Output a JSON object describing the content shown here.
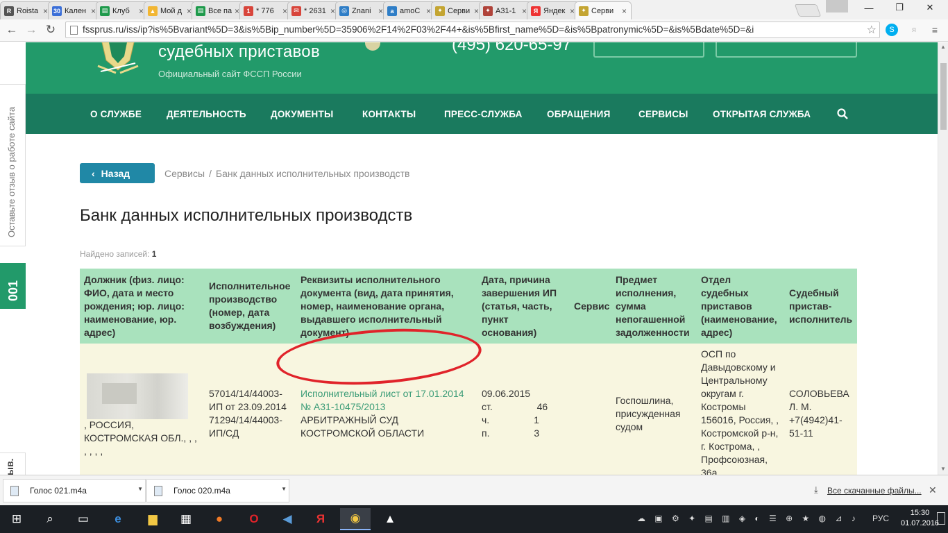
{
  "browser": {
    "tabs": [
      {
        "title": "Roista",
        "fav_color": "#555555",
        "fav_text": "R"
      },
      {
        "title": "Кален",
        "fav_color": "#3b6fd8",
        "fav_text": "30"
      },
      {
        "title": "Клуб",
        "fav_color": "#1e9a4b",
        "fav_text": "▤"
      },
      {
        "title": "Мой д",
        "fav_color": "#f2b632",
        "fav_text": "▲"
      },
      {
        "title": "Все па",
        "fav_color": "#1e9a4b",
        "fav_text": "▤"
      },
      {
        "title": "* 776",
        "fav_color": "#d8453b",
        "fav_text": "1"
      },
      {
        "title": "* 2631",
        "fav_color": "#d8453b",
        "fav_text": "✉"
      },
      {
        "title": "Znani",
        "fav_color": "#2f7ec7",
        "fav_text": "◎"
      },
      {
        "title": "amoC",
        "fav_color": "#2f7ec7",
        "fav_text": "a"
      },
      {
        "title": "Серви",
        "fav_color": "#c4a532",
        "fav_text": "✦"
      },
      {
        "title": "А31-1",
        "fav_color": "#b0433a",
        "fav_text": "✦"
      },
      {
        "title": "Яндек",
        "fav_color": "#e33",
        "fav_text": "Я"
      },
      {
        "title": "Серви",
        "fav_color": "#c4a532",
        "fav_text": "✦"
      }
    ],
    "url": "fssprus.ru/iss/ip?is%5Bvariant%5D=3&is%5Bip_number%5D=35906%2F14%2F03%2F44+&is%5Bfirst_name%5D=&is%5Bpatronymic%5D=&is%5Bdate%5D=&i",
    "back_icon": "←",
    "forward_icon": "→",
    "reload_icon": "↻"
  },
  "site": {
    "title": "судебных приставов",
    "subtitle": "Официальный сайт ФССП России",
    "phone": "(495) 620-65-97",
    "nav": [
      "О СЛУЖБЕ",
      "ДЕЯТЕЛЬНОСТЬ",
      "ДОКУМЕНТЫ",
      "КОНТАКТЫ",
      "ПРЕСС-СЛУЖБА",
      "ОБРАЩЕНИЯ",
      "СЕРВИСЫ",
      "ОТКРЫТАЯ СЛУЖБА"
    ],
    "feedback_label": "Оставьте отзыв о работе сайта",
    "badge": "001",
    "side_stub": "ыв."
  },
  "page": {
    "back_label": "Назад",
    "breadcrumb": [
      "Сервисы",
      "Банк данных исполнительных производств"
    ],
    "title": "Банк данных исполнительных производств",
    "found_label": "Найдено записей:",
    "found_count": "1",
    "table": {
      "headers": [
        "Должник (физ. лицо: ФИО, дата и место рождения; юр. лицо: наименование, юр. адрес)",
        "Исполнительное производство (номер, дата возбуждения)",
        "Реквизиты исполнительного документа (вид, дата принятия, номер, наименование органа, выдавшего исполнительный документ)",
        "Дата, причина завершения ИП (статья, часть, пункт основания)",
        "Сервис",
        "Предмет исполнения, сумма непогашенной задолженности",
        "Отдел судебных приставов (наименование, адрес)",
        "Судебный пристав-исполнитель"
      ],
      "row": {
        "debtor_visible": ", РОССИЯ, КОСТРОМСКАЯ ОБЛ., , , , , , ,",
        "proceeding": "57014/14/44003-ИП от 23.09.2014 71294/14/44003-ИП/СД",
        "document_link": "Исполнительный лист от 17.01.2014 № А31-10475/2013",
        "document_issuer": "АРБИТРАЖНЫЙ СУД КОСТРОМСКОЙ ОБЛАСТИ",
        "completion": "09.06.2015 ст. 46 ч. 1 п. 3",
        "service": "",
        "subject": "Госпошлина, присужденная судом",
        "department": "ОСП по Давыдовскому и Центральному округам г. Костромы 156016, Россия, , Костромской р-н, г. Кострома, , Профсоюзная, 36а",
        "bailiff": "СОЛОВЬЕВА Л. М. +7(4942)41-51-11"
      }
    }
  },
  "downloads": {
    "items": [
      "Голос 021.m4a",
      "Голос 020.m4a"
    ],
    "show_all": "Все скачанные файлы..."
  },
  "taskbar": {
    "lang": "РУС",
    "time": "15:30",
    "date": "01.07.2016"
  }
}
